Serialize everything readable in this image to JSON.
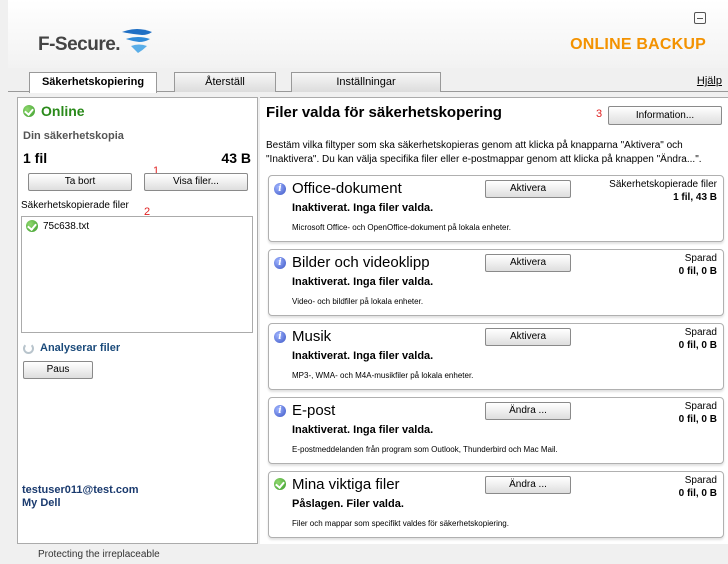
{
  "header": {
    "logo_text": "F-Secure.",
    "brand": "ONLINE BACKUP"
  },
  "tabs": [
    {
      "label": "Säkerhetskopiering",
      "active": true
    },
    {
      "label": "Återställ",
      "active": false
    },
    {
      "label": "Inställningar",
      "active": false
    }
  ],
  "help_label": "Hjälp",
  "sidebar": {
    "status": "Online",
    "backup_title": "Din säkerhetskopia",
    "file_count": "1 fil",
    "size": "43 B",
    "delete_button": "Ta bort",
    "show_files_button": "Visa filer...",
    "files_label": "Säkerhetskopierade filer",
    "files": [
      "75c638.txt"
    ],
    "analyzing_label": "Analyserar filer",
    "pause_button": "Paus",
    "account_email": "testuser011@test.com",
    "account_name": "My Dell"
  },
  "annotations": {
    "one": "1",
    "two": "2",
    "three": "3"
  },
  "main": {
    "title": "Filer valda för säkerhetskopering",
    "info_button": "Information...",
    "description": "Bestäm vilka filtyper som ska säkerhetskopieras genom att klicka på knapparna \"Aktivera\" och \"Inaktivera\". Du kan välja specifika filer eller e-postmappar genom att klicka på knappen \"Ändra...\".",
    "categories": [
      {
        "title": "Office-dokument",
        "state": "Inaktiverat. Inga filer valda.",
        "subtitle": "Microsoft Office- och OpenOffice-dokument på lokala enheter.",
        "button": "Aktivera",
        "status_label": "Säkerhetskopierade filer",
        "status_value": "1 fil, 43 B",
        "icon": "info-icon"
      },
      {
        "title": "Bilder och videoklipp",
        "state": "Inaktiverat. Inga filer valda.",
        "subtitle": "Video- och bildfiler på lokala enheter.",
        "button": "Aktivera",
        "status_label": "Sparad",
        "status_value": "0 fil, 0 B",
        "icon": "info-icon"
      },
      {
        "title": "Musik",
        "state": "Inaktiverat. Inga filer valda.",
        "subtitle": "MP3-, WMA- och M4A-musikfiler på lokala enheter.",
        "button": "Aktivera",
        "status_label": "Sparad",
        "status_value": "0 fil, 0 B",
        "icon": "info-icon"
      },
      {
        "title": "E-post",
        "state": "Inaktiverat. Inga filer valda.",
        "subtitle": "E-postmeddelanden från program som Outlook, Thunderbird och Mac Mail.",
        "button": "Ändra ...",
        "status_label": "Sparad",
        "status_value": "0 fil, 0 B",
        "icon": "info-icon"
      },
      {
        "title": "Mina viktiga filer",
        "state": "Påslagen. Filer valda.",
        "subtitle": "Filer och mappar som specifikt valdes för säkerhetskopiering.",
        "button": "Ändra ...",
        "status_label": "Sparad",
        "status_value": "0 fil, 0 B",
        "icon": "check-icon"
      }
    ]
  },
  "footer": "Protecting the irreplaceable",
  "colors": {
    "brand_orange": "#f39200",
    "online_green": "#2a8a1a",
    "account_blue": "#1a3a6e",
    "annotation_red": "#e02020"
  }
}
